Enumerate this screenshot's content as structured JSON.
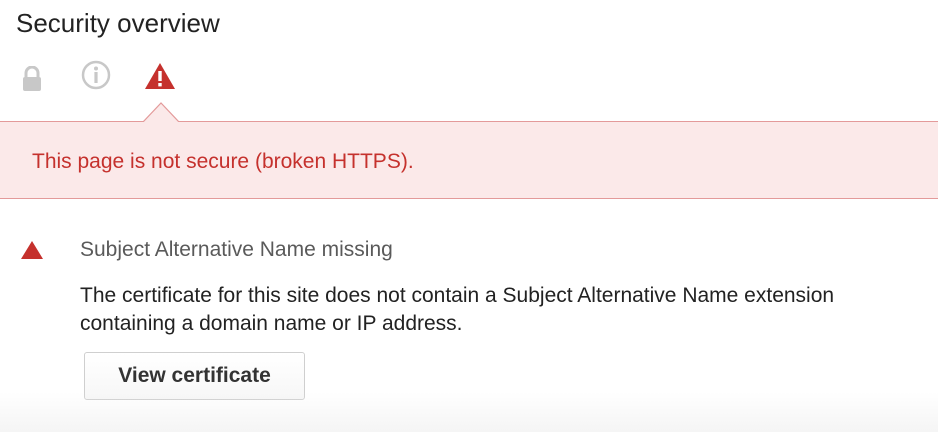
{
  "panel": {
    "title": "Security overview"
  },
  "icons": {
    "lock": "lock-icon",
    "info": "info-icon",
    "warning": "warning-icon"
  },
  "banner": {
    "text": "This page is not secure (broken HTTPS)."
  },
  "issue": {
    "title": "Subject Alternative Name missing",
    "description": "The certificate for this site does not contain a Subject Alternative Name extension containing a domain name or IP address.",
    "button_label": "View certificate"
  },
  "colors": {
    "danger": "#c5312d",
    "banner_bg": "#fbe9e9",
    "banner_border": "#e39a9a",
    "muted_icon": "#c8c8c8"
  }
}
